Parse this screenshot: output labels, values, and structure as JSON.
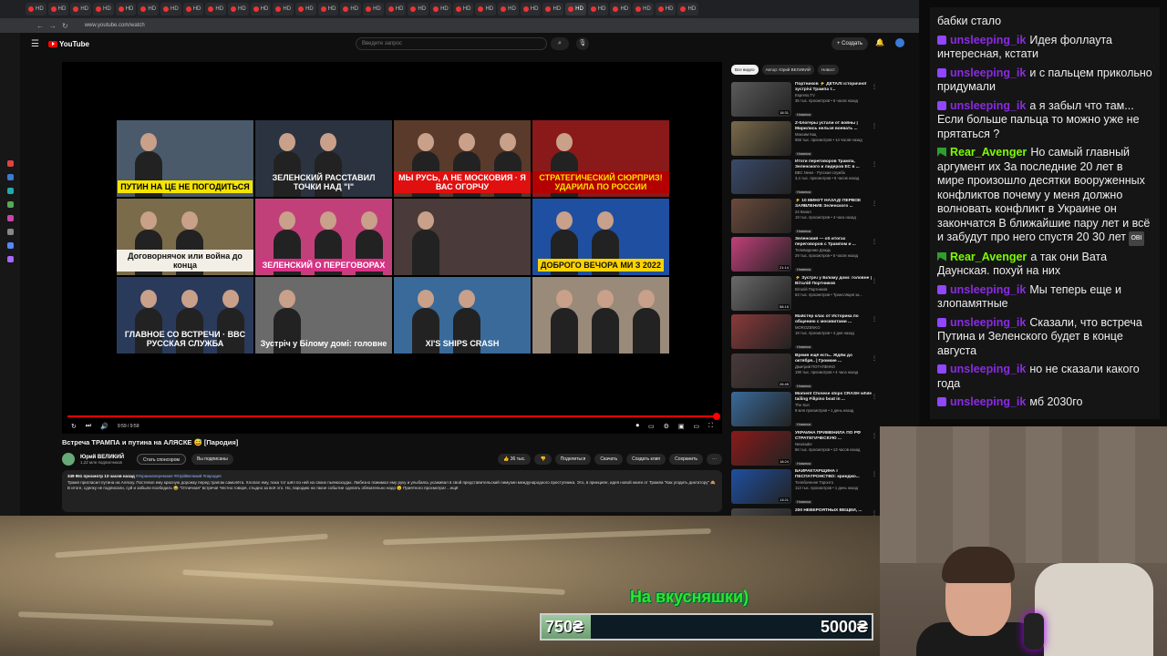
{
  "browser": {
    "tabs": [
      "HD",
      "HD",
      "HD",
      "HD",
      "HD",
      "HD",
      "HD",
      "HD",
      "HD",
      "HD",
      "HD",
      "HD",
      "HD",
      "HD",
      "HD",
      "HD",
      "HD",
      "HD",
      "HD",
      "HD",
      "HD",
      "HD",
      "HD",
      "HD",
      "HD",
      "HD",
      "HD",
      "HD",
      "HD",
      "HD"
    ],
    "url": "www.youtube.com/watch"
  },
  "youtube": {
    "logo_text": "YouTube",
    "search_placeholder": "Введите запрос",
    "create_label": "+ Создать",
    "time": "9:59 / 9:59",
    "video_title": "Встреча ТРАМПА и путина на АЛЯСКЕ 😅 [Пародия]",
    "channel_name": "Юрий ВЕЛИКИЙ",
    "channel_subs": "1,22 млн подписчиков",
    "sponsor_label": "Стать спонсором",
    "subscribed_label": "Вы подписаны",
    "actions": [
      "👍 36 тыс.",
      "👎",
      "Поделиться",
      "Скачать",
      "Создать клип",
      "Сохранить",
      "⋯"
    ],
    "desc_meta": "349 951 просмотр  13 часов назад ",
    "desc_tags": "#Украинапереможе #ЮрійВеликий #пародия",
    "desc_text": "Трамп пригласил путина на Аляску. Постелил ему красную дорожку перед трапом самолёта. Хлопал ему, пока тот шёл по ней на своих пьянкоходах. Любезно пожимал ему руку и улыбаясь усаживал в свой представительский лимузин международного преступника. Это, в принципе, идея новой книги от Трампа \"Как угодить диктатору\" 🙈 В итоге, сделку не подписали, суй и забыли пообедать 😂 \"Отличная\" встреча! Честно говоря, стыдно за всё это. Но, пародию на такое событие сделать обязательно надо 😉 Приятного просмотра! ...ещё",
    "thumbs": [
      {
        "caption": "ПУТИН НА ЦЕ НЕ ПОГОДИТЬСЯ",
        "bg": "#4a5a6a",
        "cap_bg": "#f5e400",
        "cap_color": "#000"
      },
      {
        "caption": "ЗЕЛЕНСКИЙ РАССТАВИЛ ТОЧКИ НАД \"І\"",
        "bg": "#2b3340",
        "cap_bg": "transparent",
        "cap_color": "#fff"
      },
      {
        "caption": "МЫ РУСЬ, А НЕ МОСКОВИЯ · Я ВАС ОГОРЧУ",
        "bg": "#5a3a2a",
        "cap_bg": "#e01010",
        "cap_color": "#fff"
      },
      {
        "caption": "СТРАТЕГИЧЕСКИЙ СЮРПРИЗ! УДАРИЛА ПО РОССИИ",
        "bg": "#8a1a1a",
        "cap_bg": "#b30000",
        "cap_color": "#ffe100"
      },
      {
        "caption": "Договорнячок или война до конца",
        "bg": "#7a6b4a",
        "cap_bg": "#f3efe6",
        "cap_color": "#111"
      },
      {
        "caption": "ЗЕЛЕНСКИЙ О ПЕРЕГОВОРАХ",
        "bg": "#c2407a",
        "cap_bg": "#d63384",
        "cap_color": "#fff"
      },
      {
        "caption": "",
        "bg": "#4a3a3a",
        "cap_bg": "transparent",
        "cap_color": "#fff"
      },
      {
        "caption": "ДОБРОГО ВЕЧОРА МИ З 2022",
        "bg": "#1f4fa0",
        "cap_bg": "#ffd400",
        "cap_color": "#111"
      },
      {
        "caption": "ГЛАВНОЕ СО ВСТРЕЧИ · BBC РУССКАЯ СЛУЖБА",
        "bg": "#2a3a5a",
        "cap_bg": "transparent",
        "cap_color": "#fff"
      },
      {
        "caption": "Зустріч у Білому домі: головне",
        "bg": "#6a6a6a",
        "cap_bg": "transparent",
        "cap_color": "#fff"
      },
      {
        "caption": "XI'S SHIPS CRASH",
        "bg": "#3a6a9a",
        "cap_bg": "transparent",
        "cap_color": "#fff"
      },
      {
        "caption": "",
        "bg": "#9a8a7a",
        "cap_bg": "transparent",
        "cap_color": "#fff"
      }
    ],
    "chips": [
      "Все видео",
      "Автор: Юрий ВЕЛИКИЙ",
      "Новост"
    ],
    "recommendations": [
      {
        "title": "Портников ⚡ ДЕТАЛІ історичної зустрічі Трампа т...",
        "channel": "Espreso.TV",
        "meta": "35 тыс. просмотров • 6 часов назад",
        "badge": "Новинка",
        "duration": "18:31",
        "color": "#5a5a5a"
      },
      {
        "title": "Z-блогеры устали от войны | Мирились нельзя воевать ...",
        "channel": "Максим Кац",
        "meta": "555 тыс. просмотров • 14 часов назад",
        "badge": "Новинка",
        "duration": "",
        "color": "#7a6a4a"
      },
      {
        "title": "Итоги переговоров Трампа, Зеленского и лидеров ЕС в ...",
        "channel": "BBC News - Русская служба",
        "meta": "3,4 тыс. просмотров • 6 часов назад",
        "badge": "Новинка",
        "duration": "",
        "color": "#3a4a6a"
      },
      {
        "title": "⚡ 10 МИНУТ НАЗАД! ПЕРВОЕ ЗАЯВЛЕНИЕ Зеленского ...",
        "channel": "24 Канал",
        "meta": "19 тыс. просмотров • 4 часа назад",
        "badge": "Новинка",
        "duration": "",
        "color": "#6a4a3a"
      },
      {
        "title": "Зеленский — об итогах переговоров с Трампом и ...",
        "channel": "Телевидение Дождь",
        "meta": "29 тыс. просмотров • 5 часов назад",
        "badge": "Новинка",
        "duration": "21:14",
        "color": "#c2407a"
      },
      {
        "title": "⚡ Зустріч у Білому домі: головне | Віталій Портников",
        "channel": "Віталій Портников",
        "meta": "63 тыс. просмотров • Трансляция за...",
        "badge": "",
        "duration": "58:15",
        "color": "#6a6a6a"
      },
      {
        "title": "Майстер клас от Историка по общению с москвитами ...",
        "channel": "MOROZENKO",
        "meta": "18 тыс. просмотров • 4 дня назад",
        "badge": "Новинка",
        "duration": "",
        "color": "#8a3a3a"
      },
      {
        "title": "Время ещё есть.. Ждём до октября.. | Громкие ...",
        "channel": "Дмитрий ПОТАПЕНКО",
        "meta": "190 тыс. просмотров • 4 часа назад",
        "badge": "Новинка",
        "duration": "26:45",
        "color": "#4a3a3a"
      },
      {
        "title": "Moment Chinese ships CRASH while tailing Filipino boat in ...",
        "channel": "The Sun",
        "meta": "9 млн просмотров • 1 день назад",
        "badge": "Новинка",
        "duration": "",
        "color": "#3a6a9a"
      },
      {
        "title": "УКРАИНА ПРИМЕНИЛА ПО РФ СТРАТЕГИЧЕСКУЮ ...",
        "channel": "Newsader",
        "meta": "66 тыс. просмотров • 13 часов назад",
        "badge": "Новинка",
        "duration": "18:24",
        "color": "#8a1a1a"
      },
      {
        "title": "БАЙРАКТАРЩИНА І ПЕСПАТРОНСТВО: кринджо...",
        "channel": "Телебачення Торонто",
        "meta": "113 тыс. просмотров • 1 день назад",
        "badge": "Новинка",
        "duration": "13:21",
        "color": "#1f4fa0"
      },
      {
        "title": "200 НЕВЕРОЯТНЫХ ВЕЩЕЙ, ...",
        "channel": "",
        "meta": "",
        "badge": "",
        "duration": "",
        "color": "#444"
      }
    ]
  },
  "stream": {
    "overlay_text": "На вкусняшки)",
    "goal_current": "750₴",
    "goal_target": "5000₴",
    "goal_fraction": 0.15
  },
  "chat": {
    "messages": [
      {
        "user": "",
        "text": "бабки стало",
        "color": "#9146ff",
        "badge": ""
      },
      {
        "user": "unsleeping_ik",
        "text": "Идея фоллаута интересная, кстати",
        "color": "#8a2be2",
        "badge": "sub"
      },
      {
        "user": "unsleeping_ik",
        "text": "и с пальцем прикольно придумали",
        "color": "#8a2be2",
        "badge": "sub"
      },
      {
        "user": "unsleeping_ik",
        "text": "а я забыл что там... Если больше пальца то можно уже не прятаться ?",
        "color": "#8a2be2",
        "badge": "sub"
      },
      {
        "user": "Rear_Avenger",
        "text": "Но самый главный аргумент их За последние 20 лет в мире произошло десятки вооруженных конфликтов почему у меня должно волновать конфликт в Украине он закончатся В ближайшие пару лет и всё и забудут про него спустя 20 30 лет",
        "color": "#7cfc00",
        "badge": "mod",
        "emote": "OBI"
      },
      {
        "user": "Rear_Avenger",
        "text": "а так они Вата Даунская. похуй на них",
        "color": "#7cfc00",
        "badge": "mod"
      },
      {
        "user": "unsleeping_ik",
        "text": "Мы теперь еще и злопамятные",
        "color": "#8a2be2",
        "badge": "sub"
      },
      {
        "user": "unsleeping_ik",
        "text": "Сказали, что встреча Путина и Зеленского будет в конце августа",
        "color": "#8a2be2",
        "badge": "sub"
      },
      {
        "user": "unsleeping_ik",
        "text": "но не сказали какого года",
        "color": "#8a2be2",
        "badge": "sub"
      },
      {
        "user": "unsleeping_ik",
        "text": "мб 2030го",
        "color": "#8a2be2",
        "badge": "sub"
      }
    ]
  }
}
